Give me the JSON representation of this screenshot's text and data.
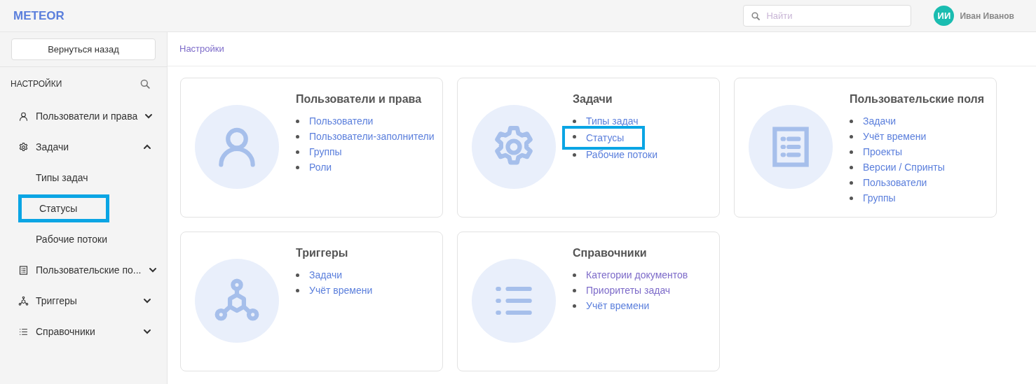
{
  "header": {
    "logo": "METEOR",
    "search": {
      "placeholder": "Найти"
    },
    "user": {
      "initials": "ИИ",
      "name": "Иван Иванов"
    }
  },
  "sidebar": {
    "back_button": "Вернуться назад",
    "title": "НАСТРОЙКИ",
    "items": [
      {
        "label": "Пользователи и права",
        "kind": "user",
        "expanded": false
      },
      {
        "label": "Задачи",
        "kind": "gear",
        "expanded": true,
        "children": [
          {
            "label": "Типы задач",
            "highlighted": false
          },
          {
            "label": "Статусы",
            "highlighted": true
          },
          {
            "label": "Рабочие потоки",
            "highlighted": false
          }
        ]
      },
      {
        "label": "Пользовательские по...",
        "kind": "form",
        "expanded": false
      },
      {
        "label": "Триггеры",
        "kind": "triggers",
        "expanded": false
      },
      {
        "label": "Справочники",
        "kind": "list",
        "expanded": false
      }
    ]
  },
  "breadcrumb": "Настройки",
  "cards": [
    {
      "title": "Пользователи и права",
      "kind": "user",
      "links": [
        {
          "label": "Пользователи",
          "visited": false,
          "highlighted": false
        },
        {
          "label": "Пользователи-заполнители",
          "visited": false,
          "highlighted": false
        },
        {
          "label": "Группы",
          "visited": false,
          "highlighted": false
        },
        {
          "label": "Роли",
          "visited": false,
          "highlighted": false
        }
      ]
    },
    {
      "title": "Задачи",
      "kind": "gear",
      "links": [
        {
          "label": "Типы задач",
          "visited": false,
          "highlighted": false
        },
        {
          "label": "Статусы",
          "visited": false,
          "highlighted": true
        },
        {
          "label": "Рабочие потоки",
          "visited": false,
          "highlighted": false
        }
      ]
    },
    {
      "title": "Пользовательские поля",
      "kind": "form",
      "links": [
        {
          "label": "Задачи",
          "visited": false,
          "highlighted": false
        },
        {
          "label": "Учёт времени",
          "visited": false,
          "highlighted": false
        },
        {
          "label": "Проекты",
          "visited": false,
          "highlighted": false
        },
        {
          "label": "Версии / Спринты",
          "visited": false,
          "highlighted": false
        },
        {
          "label": "Пользователи",
          "visited": false,
          "highlighted": false
        },
        {
          "label": "Группы",
          "visited": false,
          "highlighted": false
        }
      ]
    },
    {
      "title": "Триггеры",
      "kind": "triggers",
      "links": [
        {
          "label": "Задачи",
          "visited": false,
          "highlighted": false
        },
        {
          "label": "Учёт времени",
          "visited": false,
          "highlighted": false
        }
      ]
    },
    {
      "title": "Справочники",
      "kind": "list",
      "links": [
        {
          "label": "Категории документов",
          "visited": true,
          "highlighted": false
        },
        {
          "label": "Приоритеты задач",
          "visited": true,
          "highlighted": false
        },
        {
          "label": "Учёт времени",
          "visited": false,
          "highlighted": false
        }
      ]
    }
  ]
}
